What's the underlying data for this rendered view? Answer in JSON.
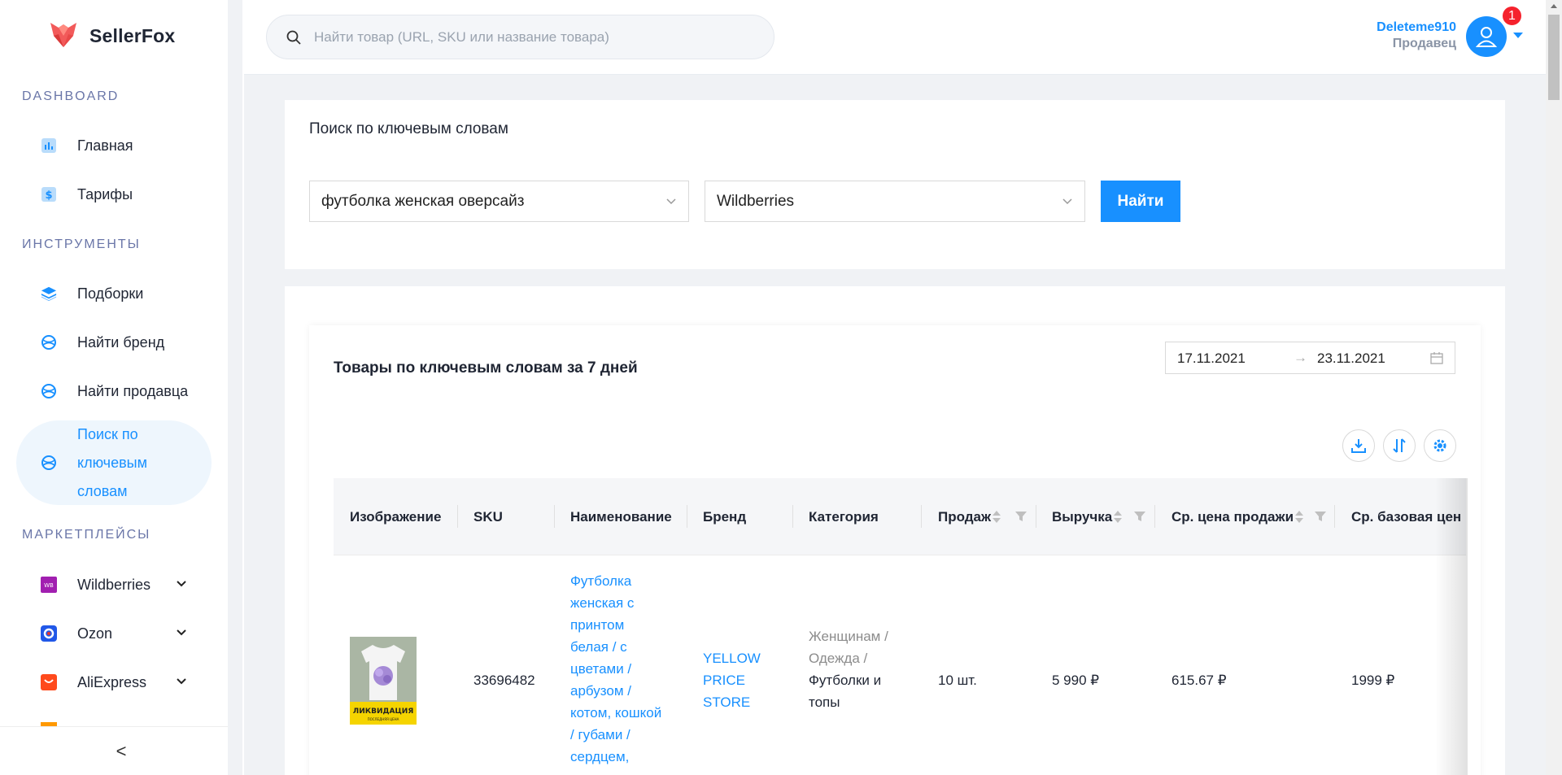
{
  "app": {
    "name": "SellerFox"
  },
  "sidebar": {
    "sections": [
      {
        "title": "DASHBOARD"
      },
      {
        "title": "ИНСТРУМЕНТЫ"
      },
      {
        "title": "МАРКЕТПЛЕЙСЫ"
      }
    ],
    "items": [
      {
        "label": "Главная",
        "icon": "chart-icon"
      },
      {
        "label": "Тарифы",
        "icon": "dollar-icon"
      },
      {
        "label": "Подборки",
        "icon": "layers-icon"
      },
      {
        "label": "Найти бренд",
        "icon": "globe-icon"
      },
      {
        "label": "Найти продавца",
        "icon": "globe-icon"
      },
      {
        "label": "Поиск по ключевым словам",
        "icon": "globe-icon",
        "active": true
      },
      {
        "label": "Wildberries",
        "icon": "wildberries-logo-icon"
      },
      {
        "label": "Ozon",
        "icon": "ozon-logo-icon"
      },
      {
        "label": "AliExpress",
        "icon": "aliexpress-logo-icon"
      }
    ],
    "wb_logo_text": "WB",
    "collapse_label": "<"
  },
  "header": {
    "search_placeholder": "Найти товар (URL, SKU или название товара)",
    "user_name": "Deleteme910",
    "user_role": "Продавец",
    "notifications": "1"
  },
  "keyword_search": {
    "title": "Поиск по ключевым словам",
    "keyword_value": "футболка женская оверсайз",
    "marketplace_value": "Wildberries",
    "find_label": "Найти"
  },
  "results": {
    "title": "Товары по ключевым словам за 7 дней",
    "date_from": "17.11.2021",
    "date_arrow": "→",
    "date_to": "23.11.2021",
    "columns": [
      "Изображение",
      "SKU",
      "Наименование",
      "Бренд",
      "Категория",
      "Продаж",
      "Выручка",
      "Ср. цена продажи",
      "Ср. базовая цен"
    ],
    "rows": [
      {
        "image_caption": "ЛИКВИДАЦИЯ",
        "image_subcaption": "ПОСЛЕДНЯЯ ЦЕНА",
        "sku": "33696482",
        "name_lines": [
          "Футболка",
          "женская с",
          "принтом",
          "белая / с",
          "цветами /",
          "арбузом /",
          "котом, кошкой",
          "/ губами /",
          "сердцем,"
        ],
        "brand_lines": [
          "YELLOW",
          "PRICE",
          "STORE"
        ],
        "category_lines": [
          "Женщинам  /",
          "Одежда  /"
        ],
        "category_leaf_lines": [
          "Футболки и",
          "топы"
        ],
        "sales": "10 шт.",
        "revenue": "5 990 ₽",
        "avg_price": "615.67 ₽",
        "base_price": "1999 ₽"
      }
    ]
  },
  "colors": {
    "accent": "#1890ff",
    "badge": "#f5222d",
    "nav_active_bg": "#eef6fd"
  }
}
